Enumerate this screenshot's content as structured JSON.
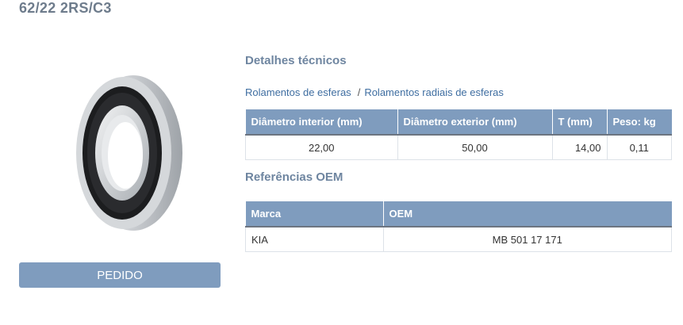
{
  "product": {
    "title": "62/22 2RS/C3"
  },
  "actions": {
    "order_label": "PEDIDO"
  },
  "details": {
    "heading": "Detalhes técnicos",
    "breadcrumb": [
      "Rolamentos de esferas",
      "Rolamentos radiais de esferas"
    ],
    "separator": "/",
    "columns": [
      "Diâmetro interior (mm)",
      "Diâmetro exterior (mm)",
      "T (mm)",
      "Peso: kg"
    ],
    "row": [
      "22,00",
      "50,00",
      "14,00",
      "0,11"
    ]
  },
  "oem": {
    "heading": "Referências OEM",
    "columns": [
      "Marca",
      "OEM"
    ],
    "rows": [
      [
        "KIA",
        "MB 501 17 171"
      ]
    ]
  },
  "colors": {
    "header_bg": "#7f9cbe",
    "heading_text": "#6e85a0",
    "link": "#3f6ea1"
  }
}
